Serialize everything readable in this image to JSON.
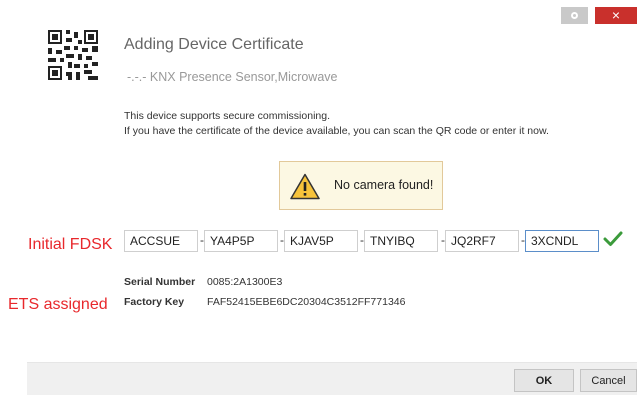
{
  "window": {
    "settings_icon": "gear-icon",
    "close_glyph": "×",
    "close_color": "#c9302c"
  },
  "header": {
    "title": "Adding Device Certificate",
    "subtitle": "-.-.- KNX Presence Sensor,Microwave",
    "icon": "qr-code-icon"
  },
  "info": {
    "line1": "This device supports secure commissioning.",
    "line2": "If you have the certificate of the device available, you can scan the QR code or enter it now."
  },
  "camera": {
    "message": "No camera found!",
    "icon": "warning-icon",
    "background": "#fcf8e3"
  },
  "annotations": {
    "initial_fdsk": "Initial FDSK",
    "ets_assigned": "ETS  assigned",
    "color": "#e8282c"
  },
  "fdsk": {
    "fields": [
      "ACCSUE",
      "YA4P5P",
      "KJAV5P",
      "TNYIBQ",
      "JQ2RF7",
      "3XCNDL"
    ],
    "separator": "-",
    "valid_icon": "checkmark-icon"
  },
  "device": {
    "serial_label": "Serial Number",
    "serial_value": "0085:2A1300E3",
    "factory_label": "Factory Key",
    "factory_value": "FAF52415EBE6DC20304C3512FF771346"
  },
  "footer": {
    "ok_label": "OK",
    "cancel_label": "Cancel"
  }
}
